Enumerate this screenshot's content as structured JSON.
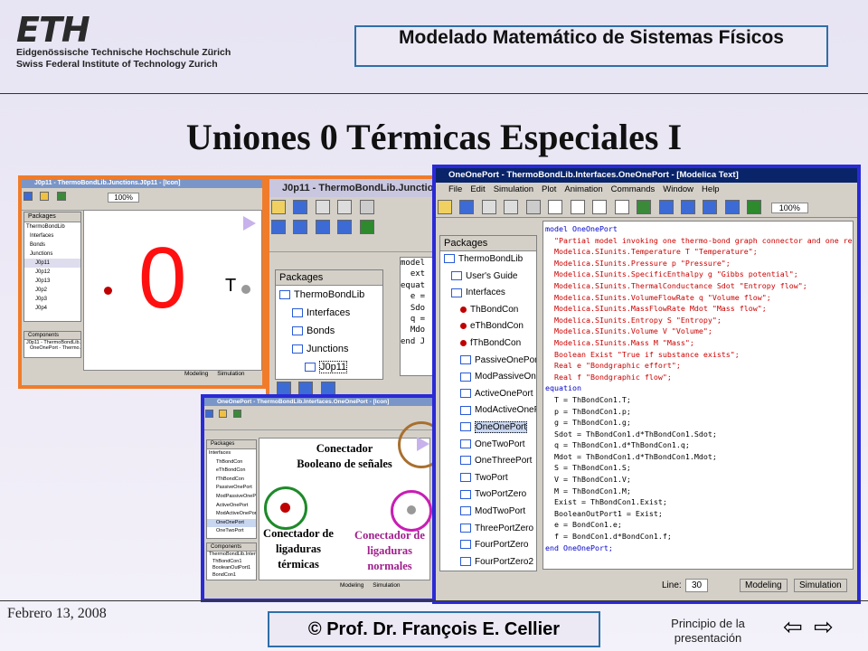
{
  "header": {
    "logo": "ETH",
    "logo_line1": "Eidgenössische Technische Hochschule Zürich",
    "logo_line2": "Swiss Federal Institute of Technology Zurich",
    "course_title": "Modelado Matemático de Sistemas Físicos"
  },
  "slide_title": "Uniones 0 Térmicas Especiales I",
  "win_left": {
    "title": "J0p11 - ThermoBondLib.Junctions.J0p11 - [Icon]",
    "packages_label": "Packages",
    "tree": [
      "ThermoBondLib",
      "Interfaces",
      "Bonds",
      "Junctions",
      "J0p11",
      "J0p12",
      "J0p13",
      "J0p2",
      "J0p3",
      "J0p4"
    ],
    "components_label": "Components",
    "component_item": "J0p11 - ThermoBondLib.Junctions...",
    "sub_item": "OneOnePort - Thermo...",
    "zero": "0",
    "t_label": "T",
    "modeling": "Modeling",
    "simulation": "Simulation",
    "zoom": "100%"
  },
  "win_mid": {
    "title": "J0p11 - ThermoBondLib.Junction",
    "packages_label": "Packages",
    "tree": [
      "ThermoBondLib",
      "Interfaces",
      "Bonds",
      "Junctions",
      "J0p11"
    ],
    "code": [
      "model",
      "  ext",
      "",
      "",
      "equat",
      "  e =",
      "  Sdo",
      "  q =",
      "  Mdo",
      "end J"
    ]
  },
  "win_bottom": {
    "title": "OneOnePort - ThermoBondLib.Interfaces.OneOnePort - [Icon]",
    "packages_label": "Packages",
    "tree": [
      "Interfaces",
      "ThBondCon",
      "eThBondCon",
      "fThBondCon",
      "PassiveOnePort",
      "ModPassiveOnePort",
      "ActiveOnePort",
      "ModActiveOnePort",
      "OneOnePort",
      "OneTwoPort"
    ],
    "components_label": "Components",
    "components": [
      "ThermoBondLib.Interfaces...",
      "ThBondCon1",
      "BooleanOutPort1",
      "BondCon1"
    ],
    "modeling": "Modeling",
    "simulation": "Simulation"
  },
  "win_right": {
    "title": "OneOnePort - ThermoBondLib.Interfaces.OneOnePort - [Modelica Text]",
    "menu": [
      "File",
      "Edit",
      "Simulation",
      "Plot",
      "Animation",
      "Commands",
      "Window",
      "Help"
    ],
    "zoom": "100%",
    "packages_label": "Packages",
    "tree": [
      "ThermoBondLib",
      "User's Guide",
      "Interfaces",
      "ThBondCon",
      "eThBondCon",
      "fThBondCon",
      "PassiveOnePort",
      "ModPassiveOnePort",
      "ActiveOnePort",
      "ModActiveOnePort",
      "OneOnePort",
      "OneTwoPort",
      "OneThreePort",
      "TwoPort",
      "TwoPortZero",
      "ModTwoPort",
      "ThreePortZero",
      "FourPortZero",
      "FourPortZero2"
    ],
    "code": [
      {
        "t": "model OneOnePort",
        "c": "k"
      },
      {
        "t": "  \"Partial model invoking one thermo-bond graph connector and one regular bon",
        "c": "s"
      },
      {
        "t": "  Modelica.SIunits.Temperature T \"Temperature\";",
        "c": "m"
      },
      {
        "t": "  Modelica.SIunits.Pressure p \"Pressure\";",
        "c": "m"
      },
      {
        "t": "  Modelica.SIunits.SpecificEnthalpy g \"Gibbs potential\";",
        "c": "m"
      },
      {
        "t": "  Modelica.SIunits.ThermalConductance Sdot \"Entropy flow\";",
        "c": "m"
      },
      {
        "t": "  Modelica.SIunits.VolumeFlowRate q \"Volume flow\";",
        "c": "m"
      },
      {
        "t": "  Modelica.SIunits.MassFlowRate Mdot \"Mass flow\";",
        "c": "m"
      },
      {
        "t": "  Modelica.SIunits.Entropy S \"Entropy\";",
        "c": "m"
      },
      {
        "t": "  Modelica.SIunits.Volume V \"Volume\";",
        "c": "m"
      },
      {
        "t": "  Modelica.SIunits.Mass M \"Mass\";",
        "c": "m"
      },
      {
        "t": "  Boolean Exist \"True if substance exists\";",
        "c": "m"
      },
      {
        "t": "  Real e \"Bondgraphic effort\";",
        "c": "m"
      },
      {
        "t": "  Real f \"Bondgraphic flow\";",
        "c": "m"
      },
      {
        "t": "",
        "c": "p"
      },
      {
        "t": "equation",
        "c": "k"
      },
      {
        "t": "  T = ThBondCon1.T;",
        "c": "p"
      },
      {
        "t": "  p = ThBondCon1.p;",
        "c": "p"
      },
      {
        "t": "  g = ThBondCon1.g;",
        "c": "p"
      },
      {
        "t": "  Sdot = ThBondCon1.d*ThBondCon1.Sdot;",
        "c": "p"
      },
      {
        "t": "  q = ThBondCon1.d*ThBondCon1.q;",
        "c": "p"
      },
      {
        "t": "  Mdot = ThBondCon1.d*ThBondCon1.Mdot;",
        "c": "p"
      },
      {
        "t": "  S = ThBondCon1.S;",
        "c": "p"
      },
      {
        "t": "  V = ThBondCon1.V;",
        "c": "p"
      },
      {
        "t": "  M = ThBondCon1.M;",
        "c": "p"
      },
      {
        "t": "  Exist = ThBondCon1.Exist;",
        "c": "p"
      },
      {
        "t": "  BooleanOutPort1 = Exist;",
        "c": "p"
      },
      {
        "t": "  e = BondCon1.e;",
        "c": "p"
      },
      {
        "t": "  f = BondCon1.d*BondCon1.f;",
        "c": "p"
      },
      {
        "t": "end OneOnePort;",
        "c": "k"
      }
    ],
    "status_line": "Line:",
    "status_num": "30",
    "modeling": "Modeling",
    "simulation": "Simulation"
  },
  "annotations": {
    "boolean": "Conectador Booleano de señales",
    "thermal": "Conectador de ligaduras térmicas",
    "normal": "Conectador de ligaduras normales"
  },
  "colors": {
    "orange_frame": "#f07c2a",
    "blue_frame": "#2a2ad6",
    "brown_circle": "#a8702e",
    "green_circle": "#1e8a2a",
    "magenta_circle": "#c81eb4"
  },
  "footer": {
    "date": "Febrero 13, 2008",
    "author": "© Prof. Dr. François E. Cellier",
    "link": "Principio de la presentación"
  }
}
